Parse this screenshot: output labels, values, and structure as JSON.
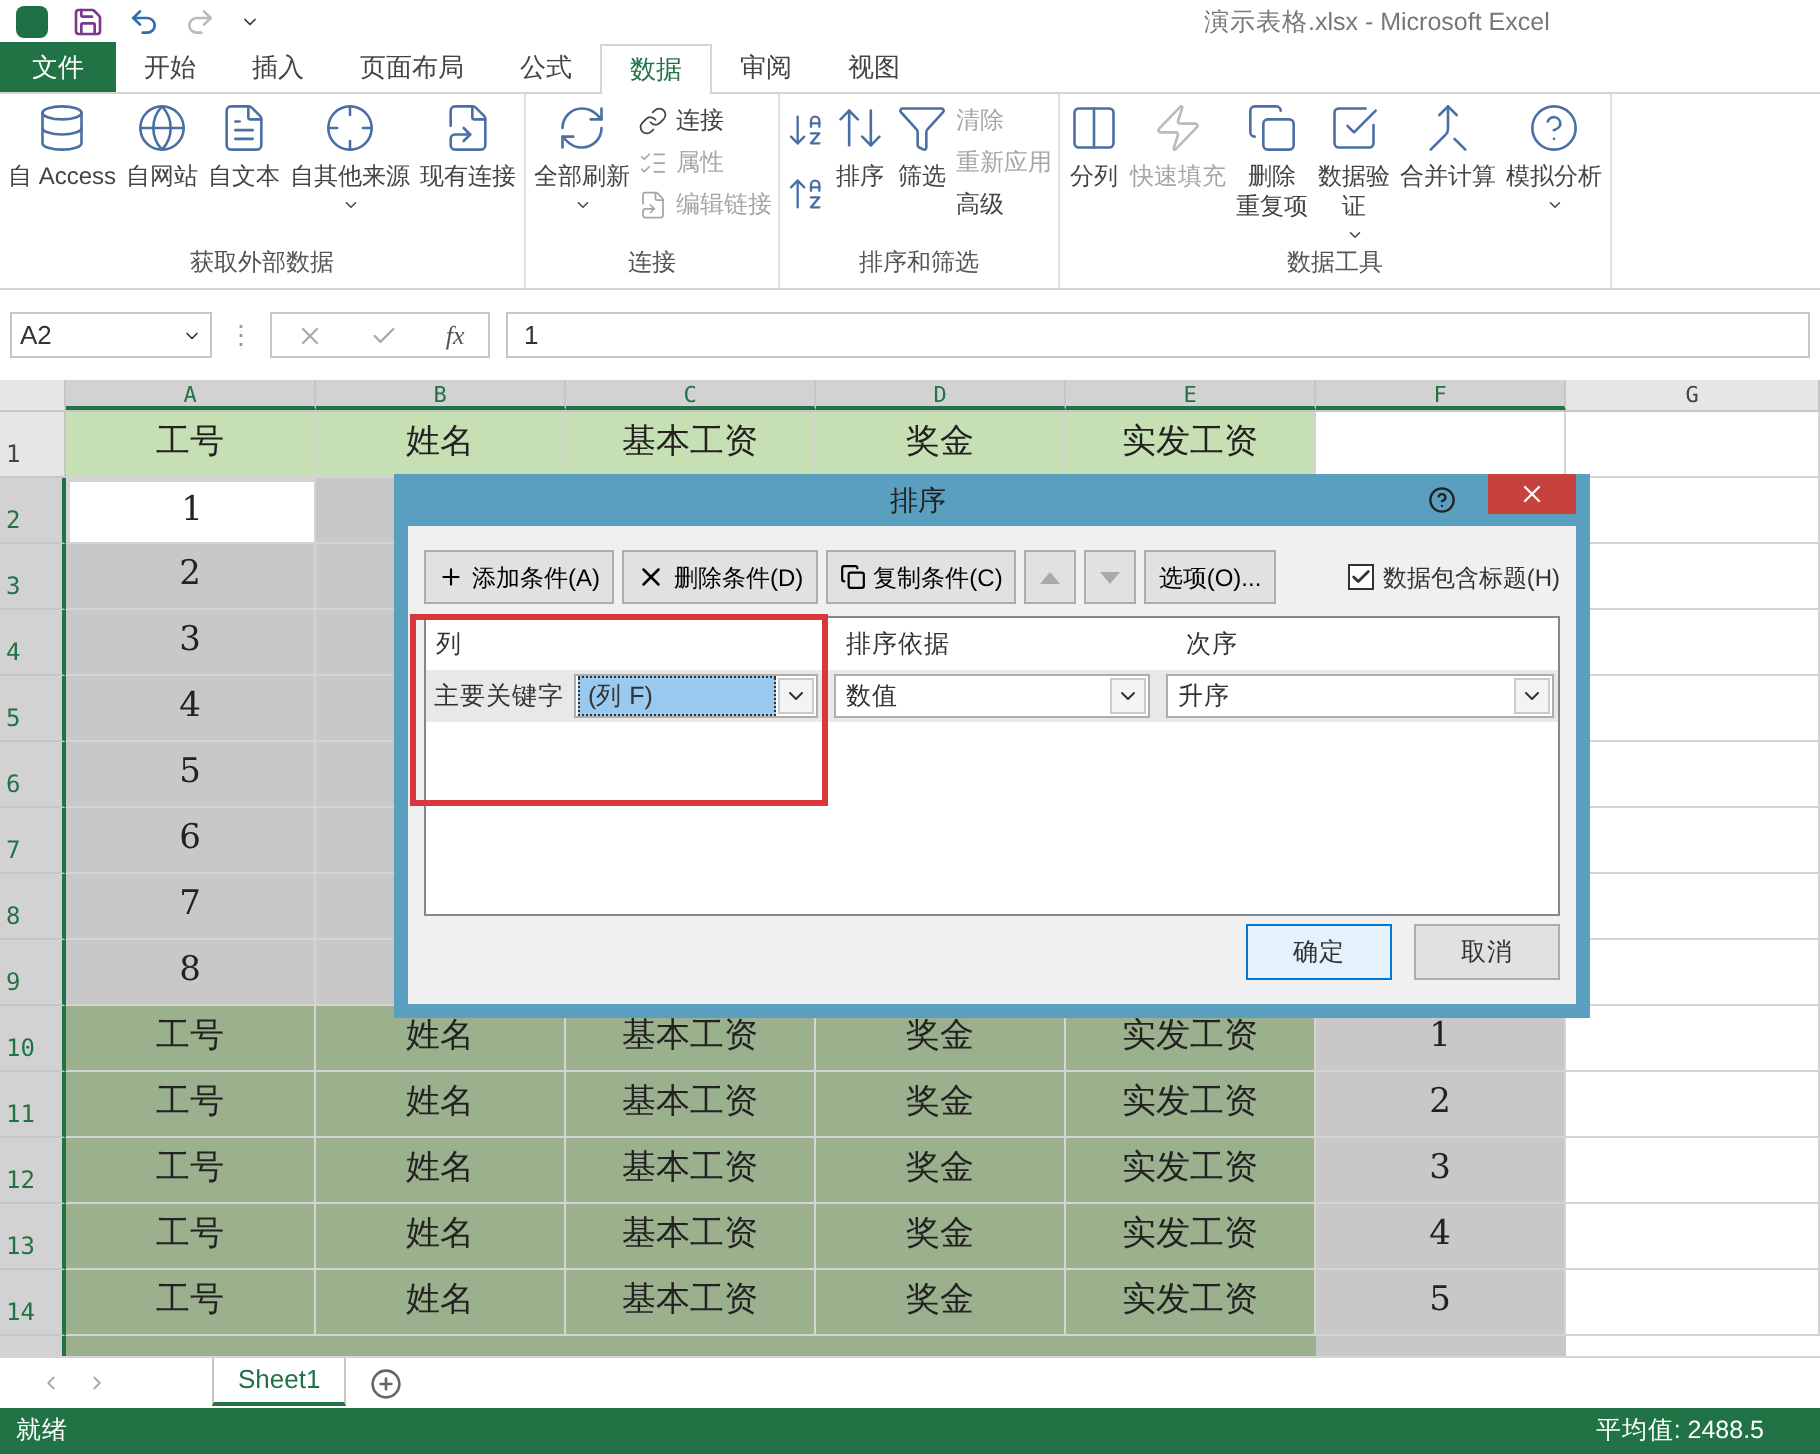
{
  "window": {
    "title": "演示表格.xlsx - Microsoft Excel"
  },
  "tabs": [
    {
      "label": "文件",
      "kind": "file",
      "selected": false
    },
    {
      "label": "开始",
      "kind": "tab",
      "selected": false
    },
    {
      "label": "插入",
      "kind": "tab",
      "selected": false
    },
    {
      "label": "页面布局",
      "kind": "tab",
      "selected": false
    },
    {
      "label": "公式",
      "kind": "tab",
      "selected": false
    },
    {
      "label": "数据",
      "kind": "tab",
      "selected": true
    },
    {
      "label": "审阅",
      "kind": "tab",
      "selected": false
    },
    {
      "label": "视图",
      "kind": "tab",
      "selected": false
    }
  ],
  "ribbon": [
    {
      "label": "获取外部数据",
      "items": [
        {
          "kind": "large",
          "lines": [
            "自 Access"
          ],
          "disabled": false,
          "dropdown": false
        },
        {
          "kind": "large",
          "lines": [
            "自网站"
          ],
          "disabled": false,
          "dropdown": false
        },
        {
          "kind": "large",
          "lines": [
            "自文本"
          ],
          "disabled": false,
          "dropdown": false
        },
        {
          "kind": "large",
          "lines": [
            "自其他来源"
          ],
          "disabled": false,
          "dropdown": true
        },
        {
          "kind": "large",
          "lines": [
            "现有连接"
          ],
          "disabled": false,
          "dropdown": false
        }
      ]
    },
    {
      "label": "连接",
      "items": [
        {
          "kind": "large",
          "lines": [
            "全部刷新"
          ],
          "disabled": false,
          "dropdown": true
        },
        {
          "kind": "stack",
          "entries": [
            {
              "label": "连接",
              "disabled": false
            },
            {
              "label": "属性",
              "disabled": true
            },
            {
              "label": "编辑链接",
              "disabled": true
            }
          ]
        }
      ]
    },
    {
      "label": "排序和筛选",
      "items": [
        {
          "kind": "sorticons"
        },
        {
          "kind": "large",
          "lines": [
            "排序"
          ],
          "disabled": false,
          "dropdown": false
        },
        {
          "kind": "large",
          "lines": [
            "筛选"
          ],
          "disabled": false,
          "dropdown": false
        },
        {
          "kind": "stack",
          "entries": [
            {
              "label": "清除",
              "disabled": true
            },
            {
              "label": "重新应用",
              "disabled": true
            },
            {
              "label": "高级",
              "disabled": false
            }
          ]
        }
      ]
    },
    {
      "label": "数据工具",
      "items": [
        {
          "kind": "large",
          "lines": [
            "分列"
          ],
          "disabled": false,
          "dropdown": false
        },
        {
          "kind": "large",
          "lines": [
            "快速填充"
          ],
          "disabled": true,
          "dropdown": false
        },
        {
          "kind": "large",
          "lines": [
            "删除",
            "重复项"
          ],
          "disabled": false,
          "dropdown": false
        },
        {
          "kind": "large",
          "lines": [
            "数据验",
            "证"
          ],
          "disabled": false,
          "dropdown": true
        },
        {
          "kind": "large",
          "lines": [
            "合并计算"
          ],
          "disabled": false,
          "dropdown": false
        },
        {
          "kind": "large",
          "lines": [
            "模拟分析"
          ],
          "disabled": false,
          "dropdown": true
        }
      ]
    }
  ],
  "formula_bar": {
    "name_box": "A2",
    "separator": "⋮",
    "function_label": "fx",
    "value": "1"
  },
  "columns": [
    {
      "label": "A",
      "selected": true
    },
    {
      "label": "B",
      "selected": true
    },
    {
      "label": "C",
      "selected": true
    },
    {
      "label": "D",
      "selected": true
    },
    {
      "label": "E",
      "selected": true
    },
    {
      "label": "F",
      "selected": true
    },
    {
      "label": "G",
      "selected": false
    }
  ],
  "rows": [
    {
      "number": "1",
      "selected": false,
      "cells": [
        {
          "kind": "header",
          "text": "工号"
        },
        {
          "kind": "header",
          "text": "姓名"
        },
        {
          "kind": "header",
          "text": "基本工资"
        },
        {
          "kind": "header",
          "text": "奖金"
        },
        {
          "kind": "header",
          "text": "实发工资"
        },
        {
          "kind": "plain"
        },
        {
          "kind": "plain"
        }
      ]
    },
    {
      "number": "2",
      "selected": true,
      "cells": [
        {
          "kind": "active",
          "text": "1"
        },
        {
          "kind": "selected"
        },
        {
          "kind": "plain"
        }
      ]
    },
    {
      "number": "3",
      "selected": true,
      "cells": [
        {
          "kind": "selected",
          "text": "2"
        },
        {
          "kind": "selected"
        },
        {
          "kind": "plain"
        }
      ]
    },
    {
      "number": "4",
      "selected": true,
      "cells": [
        {
          "kind": "selected",
          "text": "3"
        },
        {
          "kind": "selected"
        },
        {
          "kind": "plain"
        }
      ]
    },
    {
      "number": "5",
      "selected": true,
      "cells": [
        {
          "kind": "selected",
          "text": "4"
        },
        {
          "kind": "selected"
        },
        {
          "kind": "plain"
        }
      ]
    },
    {
      "number": "6",
      "selected": true,
      "cells": [
        {
          "kind": "selected",
          "text": "5"
        },
        {
          "kind": "selected"
        },
        {
          "kind": "plain"
        }
      ]
    },
    {
      "number": "7",
      "selected": true,
      "cells": [
        {
          "kind": "selected",
          "text": "6"
        },
        {
          "kind": "selected"
        },
        {
          "kind": "plain"
        }
      ]
    },
    {
      "number": "8",
      "selected": true,
      "cells": [
        {
          "kind": "selected",
          "text": "7"
        },
        {
          "kind": "selected"
        },
        {
          "kind": "plain"
        }
      ]
    },
    {
      "number": "9",
      "selected": true,
      "cells": [
        {
          "kind": "selected",
          "text": "8"
        },
        {
          "kind": "selected"
        },
        {
          "kind": "plain"
        }
      ]
    },
    {
      "number": "10",
      "selected": true,
      "cells": [
        {
          "kind": "band",
          "text": "工号"
        },
        {
          "kind": "band",
          "text": "姓名"
        },
        {
          "kind": "band",
          "text": "基本工资"
        },
        {
          "kind": "band",
          "text": "奖金"
        },
        {
          "kind": "band",
          "text": "实发工资"
        },
        {
          "kind": "selected",
          "text": "1"
        },
        {
          "kind": "plain"
        }
      ]
    },
    {
      "number": "11",
      "selected": true,
      "cells": [
        {
          "kind": "band",
          "text": "工号"
        },
        {
          "kind": "band",
          "text": "姓名"
        },
        {
          "kind": "band",
          "text": "基本工资"
        },
        {
          "kind": "band",
          "text": "奖金"
        },
        {
          "kind": "band",
          "text": "实发工资"
        },
        {
          "kind": "selected",
          "text": "2"
        },
        {
          "kind": "plain"
        }
      ]
    },
    {
      "number": "12",
      "selected": true,
      "cells": [
        {
          "kind": "band",
          "text": "工号"
        },
        {
          "kind": "band",
          "text": "姓名"
        },
        {
          "kind": "band",
          "text": "基本工资"
        },
        {
          "kind": "band",
          "text": "奖金"
        },
        {
          "kind": "band",
          "text": "实发工资"
        },
        {
          "kind": "selected",
          "text": "3"
        },
        {
          "kind": "plain"
        }
      ]
    },
    {
      "number": "13",
      "selected": true,
      "cells": [
        {
          "kind": "band",
          "text": "工号"
        },
        {
          "kind": "band",
          "text": "姓名"
        },
        {
          "kind": "band",
          "text": "基本工资"
        },
        {
          "kind": "band",
          "text": "奖金"
        },
        {
          "kind": "band",
          "text": "实发工资"
        },
        {
          "kind": "selected",
          "text": "4"
        },
        {
          "kind": "plain"
        }
      ]
    },
    {
      "number": "14",
      "selected": true,
      "cells": [
        {
          "kind": "band",
          "text": "工号"
        },
        {
          "kind": "band",
          "text": "姓名"
        },
        {
          "kind": "band",
          "text": "基本工资"
        },
        {
          "kind": "band",
          "text": "奖金"
        },
        {
          "kind": "band",
          "text": "实发工资"
        },
        {
          "kind": "selected",
          "text": "5"
        },
        {
          "kind": "plain"
        }
      ]
    }
  ],
  "dialog": {
    "title": "排序",
    "highlight": true,
    "toolbar": [
      {
        "kind": "add",
        "label": "添加条件(A)",
        "disabled": false
      },
      {
        "kind": "delete",
        "label": "删除条件(D)",
        "disabled": false
      },
      {
        "kind": "copy",
        "label": "复制条件(C)",
        "disabled": false
      },
      {
        "kind": "up",
        "disabled": true
      },
      {
        "kind": "down",
        "disabled": true
      },
      {
        "kind": "text",
        "label": "选项(O)...",
        "disabled": false
      }
    ],
    "header_checkbox": {
      "label": "数据包含标题(H)",
      "checked": true
    },
    "headers": [
      "列",
      "排序依据",
      "次序"
    ],
    "conditions": [
      {
        "label": "主要关键字",
        "column": "(列 F)",
        "sort_on": "数值",
        "order": "升序"
      }
    ],
    "buttons": [
      {
        "label": "确定",
        "selected": true
      },
      {
        "label": "取消",
        "selected": false
      }
    ]
  },
  "sheet_tabs": [
    {
      "label": "Sheet1",
      "selected": true
    }
  ],
  "status_bar": {
    "state": "就绪",
    "summary": "平均值: 2488.5"
  }
}
